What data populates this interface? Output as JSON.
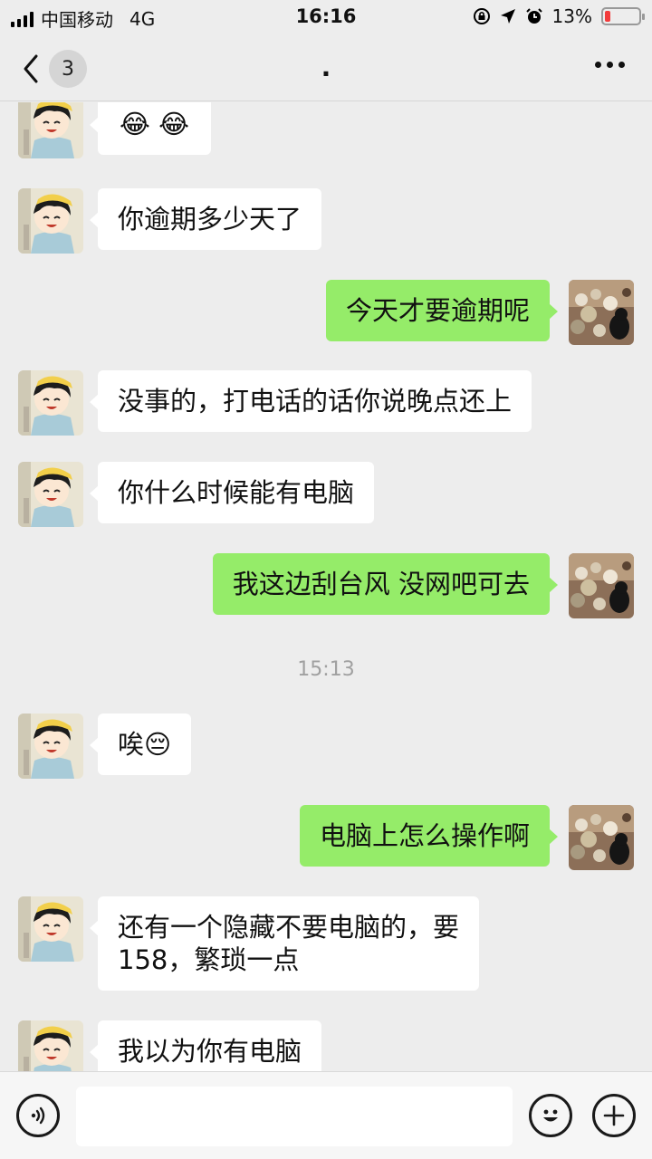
{
  "status_bar": {
    "carrier": "中国移动",
    "network": "4G",
    "time": "16:16",
    "battery": "13%",
    "battery_color": "#f23b3b"
  },
  "nav": {
    "unread_count": "3",
    "title": "."
  },
  "messages": [
    {
      "side": "in",
      "text": "😂 😂"
    },
    {
      "side": "in",
      "text": "你逾期多少天了"
    },
    {
      "side": "out",
      "text": "今天才要逾期呢"
    },
    {
      "side": "in",
      "text": "没事的，打电话的话你说晚点还上"
    },
    {
      "side": "in",
      "text": "你什么时候能有电脑"
    },
    {
      "side": "out",
      "text": "我这边刮台风 没网吧可去"
    },
    {
      "side": "in",
      "text": "唉😔"
    },
    {
      "side": "out",
      "text": "电脑上怎么操作啊"
    },
    {
      "side": "in",
      "text_line1": "还有一个隐藏不要电脑的，要",
      "text_line2": "158，繁琐一点"
    },
    {
      "side": "in",
      "text": "我以为你有电脑"
    }
  ],
  "timestamp": "15:13",
  "colors": {
    "background": "#ededed",
    "outgoing_bubble": "#95ec69",
    "incoming_bubble": "#ffffff"
  },
  "icons": {
    "back": "chevron-left-icon",
    "more": "more-icon",
    "voice": "voice-icon",
    "emoji": "emoji-icon",
    "plus": "plus-icon"
  }
}
